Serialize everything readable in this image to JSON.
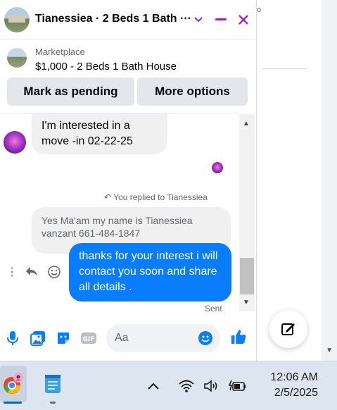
{
  "chat": {
    "title": "Tianessiea · 2 Beds 1 Bath ···",
    "marketplace_label": "Marketplace",
    "listing": "$1,000 - 2 Beds 1 Bath House",
    "mark_pending": "Mark as pending",
    "more_options": "More options"
  },
  "messages": {
    "incoming_1": "I'm interested in a move -in 02-22-25",
    "replied_label": "You replied to Tianessiea",
    "quoted": "Yes Ma'am my name is Tianessiea vanzant 661-484-1847",
    "outgoing": "thanks for your interest i will contact you soon and share all details .",
    "sent_label": "Sent"
  },
  "composer": {
    "placeholder": "Aa"
  },
  "background": {
    "fragment": "o"
  },
  "taskbar": {
    "time": "12:06 AM",
    "date": "2/5/2025"
  },
  "colors": {
    "accent_purple": "#a020d0",
    "messenger_blue": "#0a7cff",
    "icon_blue": "#0a7cff"
  }
}
